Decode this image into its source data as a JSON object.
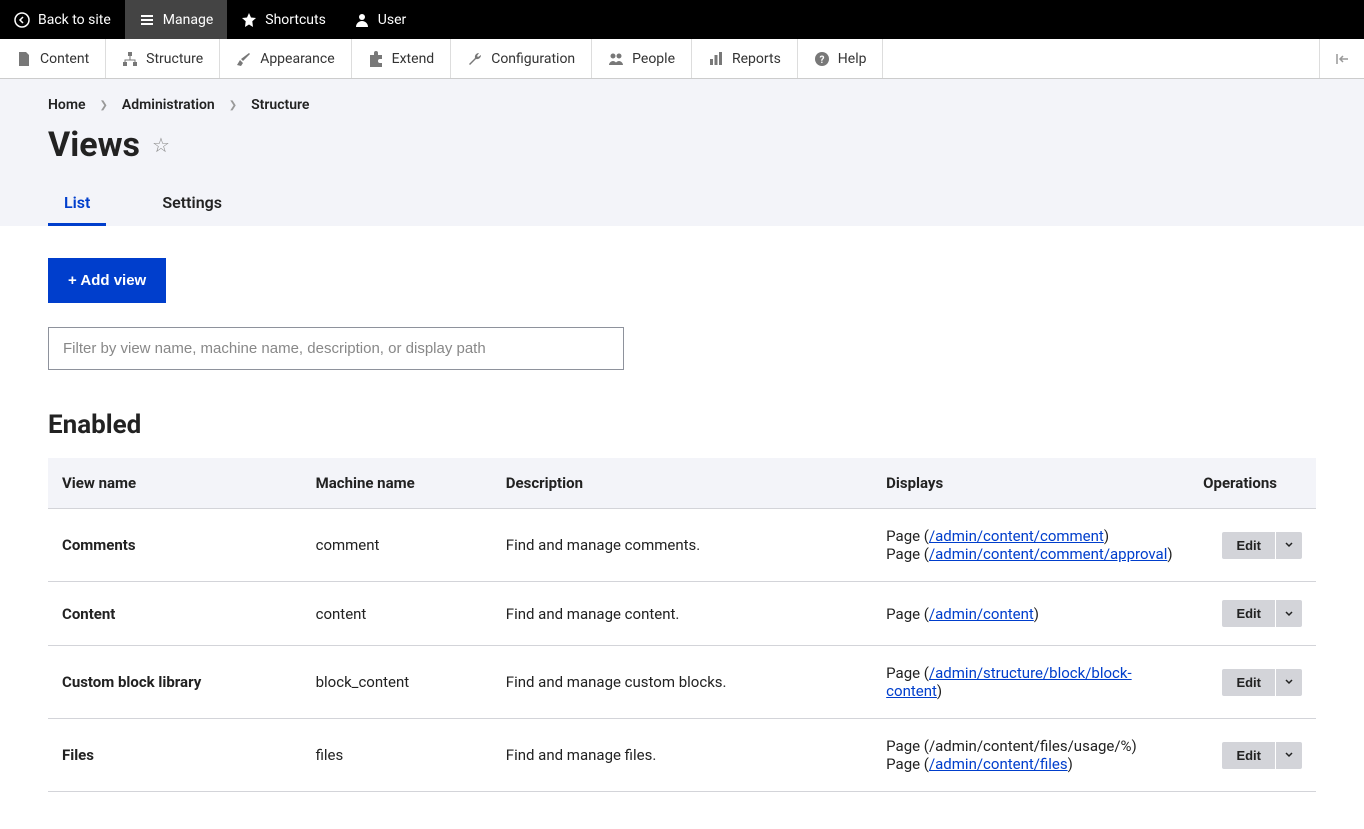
{
  "topbar": {
    "back": "Back to site",
    "manage": "Manage",
    "shortcuts": "Shortcuts",
    "user": "User"
  },
  "adminbar": {
    "content": "Content",
    "structure": "Structure",
    "appearance": "Appearance",
    "extend": "Extend",
    "configuration": "Configuration",
    "people": "People",
    "reports": "Reports",
    "help": "Help"
  },
  "breadcrumb": {
    "home": "Home",
    "administration": "Administration",
    "structure": "Structure"
  },
  "page_title": "Views",
  "tabs": {
    "list": "List",
    "settings": "Settings"
  },
  "add_button": "+ Add view",
  "filter_placeholder": "Filter by view name, machine name, description, or display path",
  "section_enabled": "Enabled",
  "table": {
    "headers": {
      "view_name": "View name",
      "machine_name": "Machine name",
      "description": "Description",
      "displays": "Displays",
      "operations": "Operations"
    },
    "rows": [
      {
        "name": "Comments",
        "machine": "comment",
        "description": "Find and manage comments.",
        "displays": [
          {
            "prefix": "Page (",
            "link": "/admin/content/comment",
            "suffix": ")"
          },
          {
            "prefix": "Page (",
            "link": "/admin/content/comment/approval",
            "suffix": ")"
          }
        ],
        "op": "Edit"
      },
      {
        "name": "Content",
        "machine": "content",
        "description": "Find and manage content.",
        "displays": [
          {
            "prefix": "Page (",
            "link": "/admin/content",
            "suffix": ")"
          }
        ],
        "op": "Edit"
      },
      {
        "name": "Custom block library",
        "machine": "block_content",
        "description": "Find and manage custom blocks.",
        "displays": [
          {
            "prefix": "Page (",
            "link": "/admin/structure/block/block-content",
            "suffix": ")"
          }
        ],
        "op": "Edit"
      },
      {
        "name": "Files",
        "machine": "files",
        "description": "Find and manage files.",
        "displays": [
          {
            "prefix": "Page (/admin/content/files/usage/%)",
            "link": "",
            "suffix": ""
          },
          {
            "prefix": "Page (",
            "link": "/admin/content/files",
            "suffix": ")"
          }
        ],
        "op": "Edit"
      }
    ]
  }
}
